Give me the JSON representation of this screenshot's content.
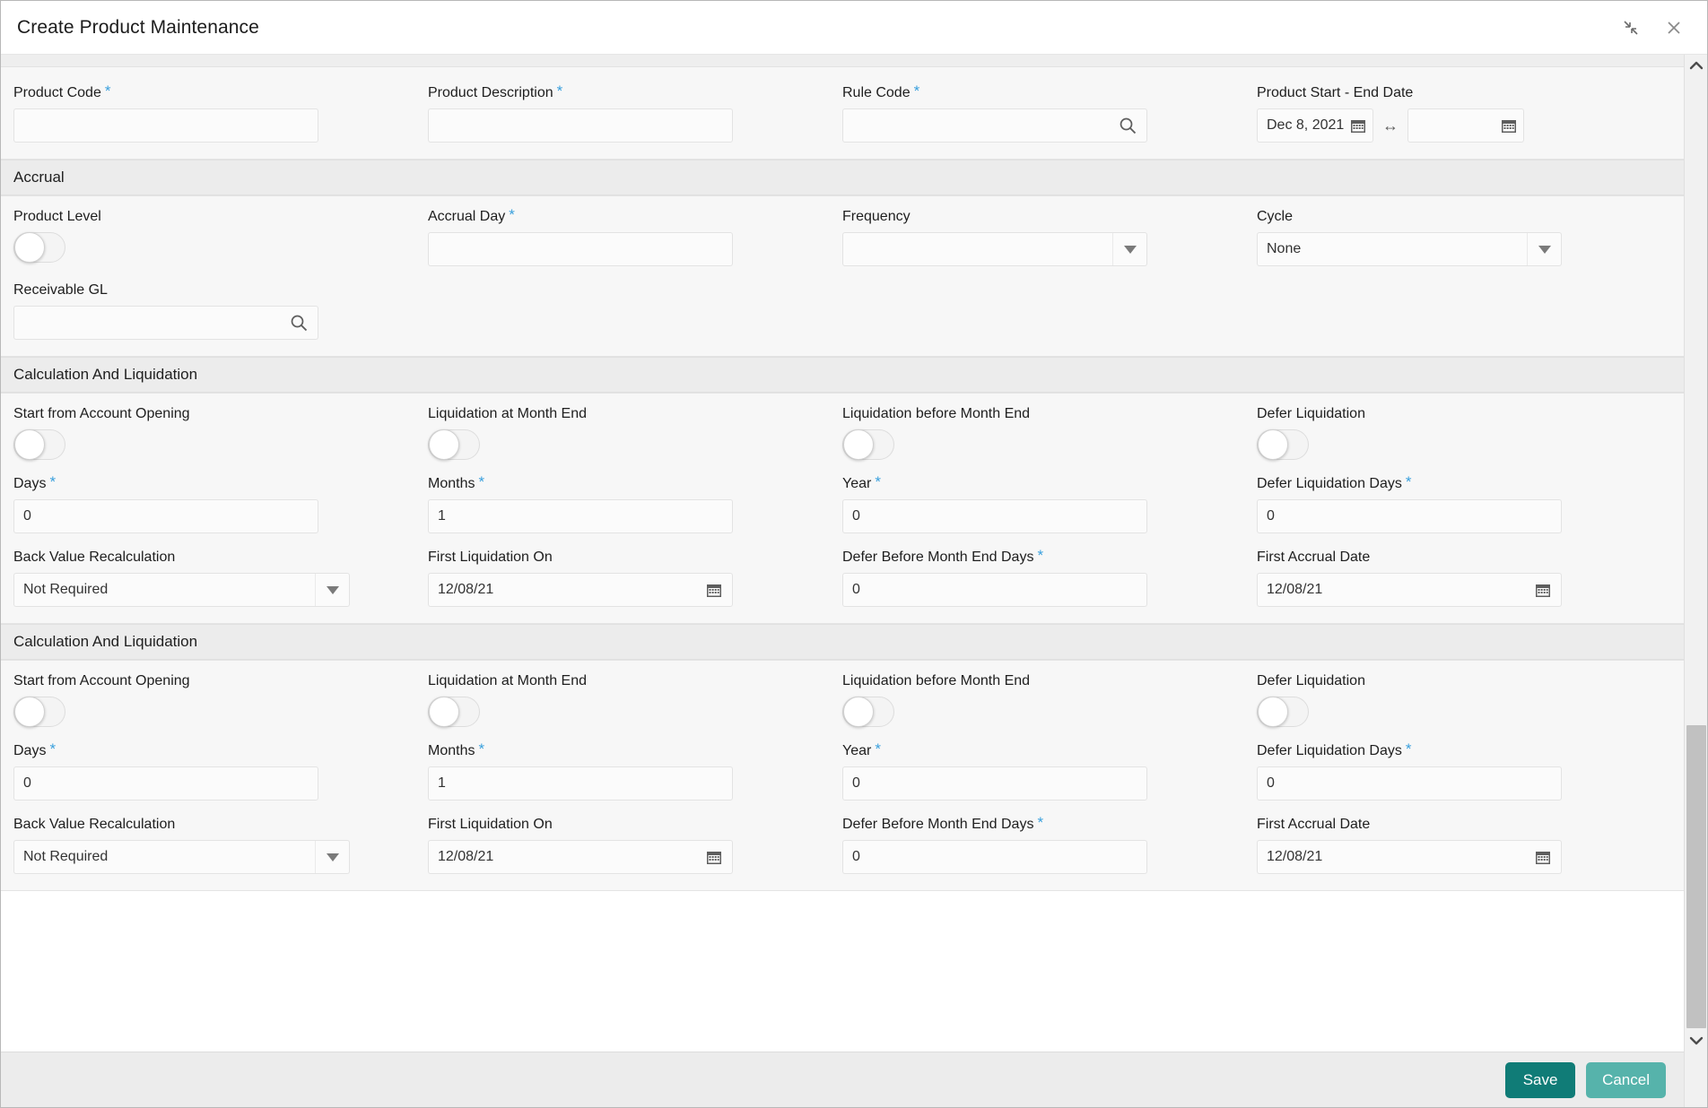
{
  "window": {
    "title": "Create Product Maintenance",
    "minimize_icon": "collapse-icon",
    "close_icon": "close-icon"
  },
  "product_section": {
    "fields": [
      {
        "label": "Product Code",
        "required": true,
        "value": "",
        "type": "text"
      },
      {
        "label": "Product Description",
        "required": true,
        "value": "",
        "type": "text"
      },
      {
        "label": "Rule Code",
        "required": true,
        "value": "",
        "type": "search"
      },
      {
        "label": "Product Start - End Date",
        "required": false,
        "type": "daterange",
        "start_value": "Dec 8, 2021",
        "end_value": "",
        "separator": "↔"
      }
    ]
  },
  "accrual_section": {
    "header": "Accrual",
    "row1": [
      {
        "label": "Product Level",
        "required": false,
        "type": "toggle",
        "state": "off"
      },
      {
        "label": "Accrual Day",
        "required": true,
        "value": "",
        "type": "text"
      },
      {
        "label": "Frequency",
        "required": false,
        "value": "",
        "type": "select"
      },
      {
        "label": "Cycle",
        "required": false,
        "value": "None",
        "type": "select"
      }
    ],
    "row2": [
      {
        "label": "Receivable GL",
        "required": false,
        "value": "",
        "type": "search"
      }
    ]
  },
  "calc_section_1": {
    "header": "Calculation And Liquidation",
    "row1": [
      {
        "label": "Start from Account Opening",
        "required": false,
        "type": "toggle",
        "state": "off"
      },
      {
        "label": "Liquidation at Month End",
        "required": false,
        "type": "toggle",
        "state": "off"
      },
      {
        "label": "Liquidation before Month End",
        "required": false,
        "type": "toggle",
        "state": "off"
      },
      {
        "label": "Defer Liquidation",
        "required": false,
        "type": "toggle",
        "state": "off"
      }
    ],
    "row2": [
      {
        "label": "Days",
        "required": true,
        "value": "0",
        "type": "text"
      },
      {
        "label": "Months",
        "required": true,
        "value": "1",
        "type": "text"
      },
      {
        "label": "Year",
        "required": true,
        "value": "0",
        "type": "text"
      },
      {
        "label": "Defer Liquidation Days",
        "required": true,
        "value": "0",
        "type": "text"
      }
    ],
    "row3": [
      {
        "label": "Back Value Recalculation",
        "required": false,
        "value": "Not Required",
        "type": "select"
      },
      {
        "label": "First Liquidation On",
        "required": false,
        "value": "12/08/21",
        "type": "date"
      },
      {
        "label": "Defer Before Month End Days",
        "required": true,
        "value": "0",
        "type": "text"
      },
      {
        "label": "First Accrual Date",
        "required": false,
        "value": "12/08/21",
        "type": "date"
      }
    ]
  },
  "calc_section_2": {
    "header": "Calculation And Liquidation",
    "row1": [
      {
        "label": "Start from Account Opening",
        "required": false,
        "type": "toggle",
        "state": "off"
      },
      {
        "label": "Liquidation at Month End",
        "required": false,
        "type": "toggle",
        "state": "off"
      },
      {
        "label": "Liquidation before Month End",
        "required": false,
        "type": "toggle",
        "state": "off"
      },
      {
        "label": "Defer Liquidation",
        "required": false,
        "type": "toggle",
        "state": "off"
      }
    ],
    "row2": [
      {
        "label": "Days",
        "required": true,
        "value": "0",
        "type": "text"
      },
      {
        "label": "Months",
        "required": true,
        "value": "1",
        "type": "text"
      },
      {
        "label": "Year",
        "required": true,
        "value": "0",
        "type": "text"
      },
      {
        "label": "Defer Liquidation Days",
        "required": true,
        "value": "0",
        "type": "text"
      }
    ],
    "row3": [
      {
        "label": "Back Value Recalculation",
        "required": false,
        "value": "Not Required",
        "type": "select"
      },
      {
        "label": "First Liquidation On",
        "required": false,
        "value": "12/08/21",
        "type": "date"
      },
      {
        "label": "Defer Before Month End Days",
        "required": true,
        "value": "0",
        "type": "text"
      },
      {
        "label": "First Accrual Date",
        "required": false,
        "value": "12/08/21",
        "type": "date"
      }
    ]
  },
  "footer": {
    "save_label": "Save",
    "cancel_label": "Cancel"
  },
  "colors": {
    "save_bg": "#107c77",
    "cancel_bg": "#56b3ab",
    "required_asterisk": "#3aa0dd",
    "section_header_bg": "#ececec",
    "panel_bg": "#f7f7f7",
    "input_bg": "#fbfbfb",
    "scrollbar_thumb": "#c1c1c1"
  },
  "scrollbar": {
    "up_arrow_icon": "chevron-up-icon",
    "down_arrow_icon": "chevron-down-icon"
  }
}
